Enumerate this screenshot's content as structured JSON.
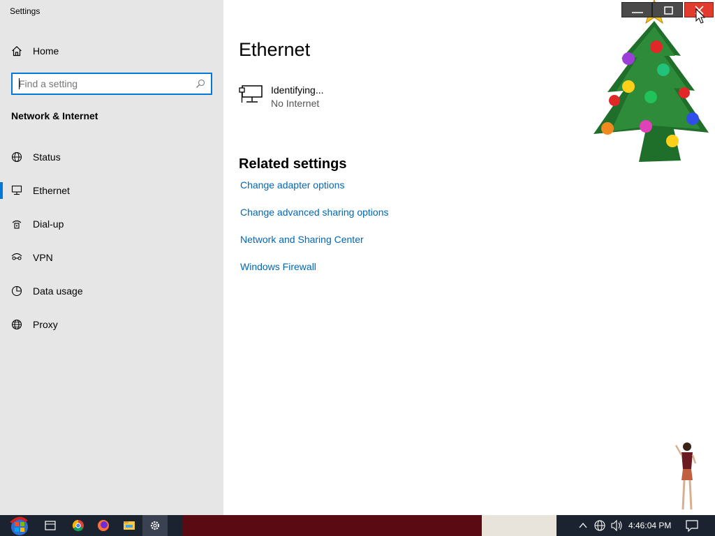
{
  "window": {
    "app_title": "Settings",
    "controls": {
      "minimize_icon": "minimize-icon",
      "maximize_icon": "maximize-icon",
      "close_icon": "close-icon"
    }
  },
  "sidebar": {
    "home": {
      "label": "Home",
      "icon": "home-icon"
    },
    "search": {
      "placeholder": "Find a setting",
      "value": "",
      "icon": "search-icon"
    },
    "section_title": "Network & Internet",
    "items": [
      {
        "label": "Status",
        "icon": "globe-network-icon",
        "active": false
      },
      {
        "label": "Ethernet",
        "icon": "ethernet-icon",
        "active": true
      },
      {
        "label": "Dial-up",
        "icon": "dialup-icon",
        "active": false
      },
      {
        "label": "VPN",
        "icon": "vpn-icon",
        "active": false
      },
      {
        "label": "Data usage",
        "icon": "data-usage-icon",
        "active": false
      },
      {
        "label": "Proxy",
        "icon": "globe-icon",
        "active": false
      }
    ]
  },
  "main": {
    "page_title": "Ethernet",
    "network": {
      "name": "Identifying...",
      "status": "No Internet",
      "icon": "ethernet-monitor-icon"
    },
    "related": {
      "title": "Related settings",
      "links": [
        "Change adapter options",
        "Change advanced sharing options",
        "Network and Sharing Center",
        "Windows Firewall"
      ]
    }
  },
  "taskbar": {
    "start_icon": "start-icon",
    "apps": [
      "task-view-icon",
      "chrome-icon",
      "firefox-icon",
      "file-explorer-icon",
      "settings-icon"
    ],
    "tray": [
      "chevron-up-icon",
      "network-icon",
      "volume-icon"
    ],
    "clock": "4:46:04 PM",
    "notification_icon": "action-center-icon"
  },
  "colors": {
    "accent": "#0078d7",
    "link": "#0067b8",
    "sidebar_bg": "#e6e6e6",
    "taskbar_bg": "#1c2330"
  }
}
